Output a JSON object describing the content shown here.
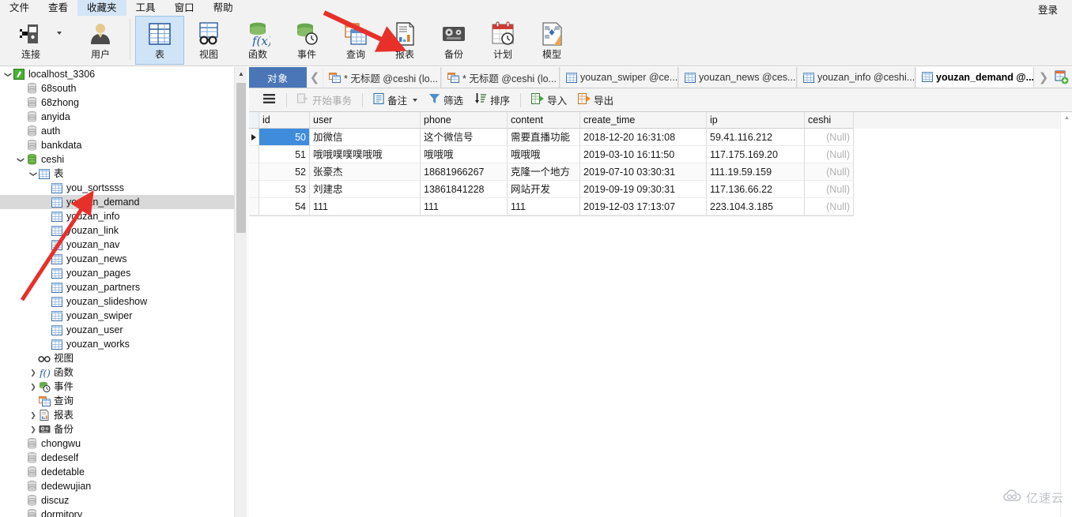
{
  "menubar": {
    "items": [
      {
        "label": "文件",
        "active": false
      },
      {
        "label": "查看",
        "active": false
      },
      {
        "label": "收藏夹",
        "active": true
      },
      {
        "label": "工具",
        "active": false
      },
      {
        "label": "窗口",
        "active": false
      },
      {
        "label": "帮助",
        "active": false
      }
    ],
    "login_label": "登录"
  },
  "ribbon": {
    "buttons": [
      {
        "label": "连接",
        "icon": "connection-icon",
        "selected": false,
        "has_caret": true
      },
      {
        "label": "用户",
        "icon": "user-icon",
        "selected": false,
        "has_caret": false
      },
      {
        "label": "表",
        "icon": "table-icon",
        "selected": true,
        "has_caret": false
      },
      {
        "label": "视图",
        "icon": "view-icon",
        "selected": false,
        "has_caret": false
      },
      {
        "label": "函数",
        "icon": "function-icon",
        "selected": false,
        "has_caret": false
      },
      {
        "label": "事件",
        "icon": "event-icon",
        "selected": false,
        "has_caret": false
      },
      {
        "label": "查询",
        "icon": "query-icon",
        "selected": false,
        "has_caret": false
      },
      {
        "label": "报表",
        "icon": "report-icon",
        "selected": false,
        "has_caret": false
      },
      {
        "label": "备份",
        "icon": "backup-icon",
        "selected": false,
        "has_caret": false
      },
      {
        "label": "计划",
        "icon": "schedule-icon",
        "selected": false,
        "has_caret": false
      },
      {
        "label": "模型",
        "icon": "model-icon",
        "selected": false,
        "has_caret": false
      }
    ]
  },
  "tree": {
    "rows": [
      {
        "label": "localhost_3306",
        "indent": 0,
        "icon": "connection-green-icon",
        "twisty": "down",
        "selected": false
      },
      {
        "label": "68south",
        "indent": 1,
        "icon": "database-gray-icon",
        "twisty": "",
        "selected": false
      },
      {
        "label": "68zhong",
        "indent": 1,
        "icon": "database-gray-icon",
        "twisty": "",
        "selected": false
      },
      {
        "label": "anyida",
        "indent": 1,
        "icon": "database-gray-icon",
        "twisty": "",
        "selected": false
      },
      {
        "label": "auth",
        "indent": 1,
        "icon": "database-gray-icon",
        "twisty": "",
        "selected": false
      },
      {
        "label": "bankdata",
        "indent": 1,
        "icon": "database-gray-icon",
        "twisty": "",
        "selected": false
      },
      {
        "label": "ceshi",
        "indent": 1,
        "icon": "database-green-icon",
        "twisty": "down",
        "selected": false
      },
      {
        "label": "表",
        "indent": 2,
        "icon": "tables-folder-icon",
        "twisty": "down",
        "selected": false
      },
      {
        "label": "you_sortssss",
        "indent": 3,
        "icon": "table-blue-icon",
        "twisty": "",
        "selected": false
      },
      {
        "label": "youzan_demand",
        "indent": 3,
        "icon": "table-blue-icon",
        "twisty": "",
        "selected": true
      },
      {
        "label": "youzan_info",
        "indent": 3,
        "icon": "table-blue-icon",
        "twisty": "",
        "selected": false
      },
      {
        "label": "youzan_link",
        "indent": 3,
        "icon": "table-blue-icon",
        "twisty": "",
        "selected": false
      },
      {
        "label": "youzan_nav",
        "indent": 3,
        "icon": "table-blue-icon",
        "twisty": "",
        "selected": false
      },
      {
        "label": "youzan_news",
        "indent": 3,
        "icon": "table-blue-icon",
        "twisty": "",
        "selected": false
      },
      {
        "label": "youzan_pages",
        "indent": 3,
        "icon": "table-blue-icon",
        "twisty": "",
        "selected": false
      },
      {
        "label": "youzan_partners",
        "indent": 3,
        "icon": "table-blue-icon",
        "twisty": "",
        "selected": false
      },
      {
        "label": "youzan_slideshow",
        "indent": 3,
        "icon": "table-blue-icon",
        "twisty": "",
        "selected": false
      },
      {
        "label": "youzan_swiper",
        "indent": 3,
        "icon": "table-blue-icon",
        "twisty": "",
        "selected": false
      },
      {
        "label": "youzan_user",
        "indent": 3,
        "icon": "table-blue-icon",
        "twisty": "",
        "selected": false
      },
      {
        "label": "youzan_works",
        "indent": 3,
        "icon": "table-blue-icon",
        "twisty": "",
        "selected": false
      },
      {
        "label": "视图",
        "indent": 2,
        "icon": "view-glasses-icon",
        "twisty": "",
        "selected": false
      },
      {
        "label": "函数",
        "indent": 2,
        "icon": "function-fx-icon",
        "twisty": "right",
        "selected": false
      },
      {
        "label": "事件",
        "indent": 2,
        "icon": "event-clock-icon",
        "twisty": "right",
        "selected": false
      },
      {
        "label": "查询",
        "indent": 2,
        "icon": "query-icon",
        "twisty": "",
        "selected": false
      },
      {
        "label": "报表",
        "indent": 2,
        "icon": "report-icon",
        "twisty": "right",
        "selected": false
      },
      {
        "label": "备份",
        "indent": 2,
        "icon": "backup-icon",
        "twisty": "right",
        "selected": false
      },
      {
        "label": "chongwu",
        "indent": 1,
        "icon": "database-gray-icon",
        "twisty": "",
        "selected": false
      },
      {
        "label": "dedeself",
        "indent": 1,
        "icon": "database-gray-icon",
        "twisty": "",
        "selected": false
      },
      {
        "label": "dedetable",
        "indent": 1,
        "icon": "database-gray-icon",
        "twisty": "",
        "selected": false
      },
      {
        "label": "dedewujian",
        "indent": 1,
        "icon": "database-gray-icon",
        "twisty": "",
        "selected": false
      },
      {
        "label": "discuz",
        "indent": 1,
        "icon": "database-gray-icon",
        "twisty": "",
        "selected": false
      },
      {
        "label": "dormitory",
        "indent": 1,
        "icon": "database-gray-icon",
        "twisty": "",
        "selected": false
      }
    ]
  },
  "tabstrip": {
    "object_tab_label": "对象",
    "tabs": [
      {
        "label": "* 无标题 @ceshi (lo...",
        "icon": "query-tab-icon",
        "active": false
      },
      {
        "label": "* 无标题 @ceshi (lo...",
        "icon": "query-tab-icon",
        "active": false
      },
      {
        "label": "youzan_swiper @ce...",
        "icon": "table-blue-icon",
        "active": false
      },
      {
        "label": "youzan_news @ces...",
        "icon": "table-blue-icon",
        "active": false
      },
      {
        "label": "youzan_info @ceshi...",
        "icon": "table-blue-icon",
        "active": false
      },
      {
        "label": "youzan_demand @...",
        "icon": "table-blue-icon",
        "active": true
      }
    ]
  },
  "actions": {
    "items": [
      {
        "label": "开始事务",
        "icon": "begin-transaction-icon",
        "disabled": true,
        "caret": false
      },
      {
        "label": "备注",
        "icon": "note-icon",
        "disabled": false,
        "caret": true
      },
      {
        "label": "筛选",
        "icon": "filter-icon",
        "disabled": false,
        "caret": false
      },
      {
        "label": "排序",
        "icon": "sort-icon",
        "disabled": false,
        "caret": false
      },
      {
        "label": "导入",
        "icon": "import-icon",
        "disabled": false,
        "caret": false
      },
      {
        "label": "导出",
        "icon": "export-icon",
        "disabled": false,
        "caret": false
      }
    ],
    "hamburger_icon": "hamburger-icon"
  },
  "grid": {
    "columns": [
      {
        "name": "id",
        "width": 64,
        "align": "right"
      },
      {
        "name": "user",
        "width": 140,
        "align": "left"
      },
      {
        "name": "phone",
        "width": 110,
        "align": "left"
      },
      {
        "name": "content",
        "width": 92,
        "align": "left"
      },
      {
        "name": "create_time",
        "width": 160,
        "align": "left"
      },
      {
        "name": "ip",
        "width": 124,
        "align": "left"
      },
      {
        "name": "ceshi",
        "width": 62,
        "align": "right"
      }
    ],
    "null_text": "(Null)",
    "rows": [
      {
        "current": true,
        "cells": [
          "50",
          "加微信",
          "这个微信号",
          "需要直播功能",
          "2018-12-20 16:31:08",
          "59.41.116.212",
          "(Null)"
        ]
      },
      {
        "current": false,
        "cells": [
          "51",
          "哦哦噗噗噗哦哦",
          "哦哦哦",
          "哦哦哦",
          "2019-03-10 16:11:50",
          "117.175.169.20",
          "(Null)"
        ]
      },
      {
        "current": false,
        "cells": [
          "52",
          "张豪杰",
          "18681966267",
          "克隆一个地方",
          "2019-07-10 03:30:31",
          "111.19.59.159",
          "(Null)"
        ]
      },
      {
        "current": false,
        "cells": [
          "53",
          "刘建忠",
          "13861841228",
          "网站开发",
          "2019-09-19 09:30:31",
          "117.136.66.22",
          "(Null)"
        ]
      },
      {
        "current": false,
        "cells": [
          "54",
          "111",
          "111",
          "111",
          "2019-12-03 17:13:07",
          "223.104.3.185",
          "(Null)"
        ]
      }
    ]
  },
  "watermark": {
    "text": "亿速云",
    "icon": "cloud-logo-icon"
  },
  "colors": {
    "accent_blue": "#4a76b8",
    "selection_blue": "#3f8cdd",
    "tree_selection": "#d9d9d9",
    "ribbon_bg": "#f2f2f2",
    "annotation_red": "#e8302a"
  }
}
